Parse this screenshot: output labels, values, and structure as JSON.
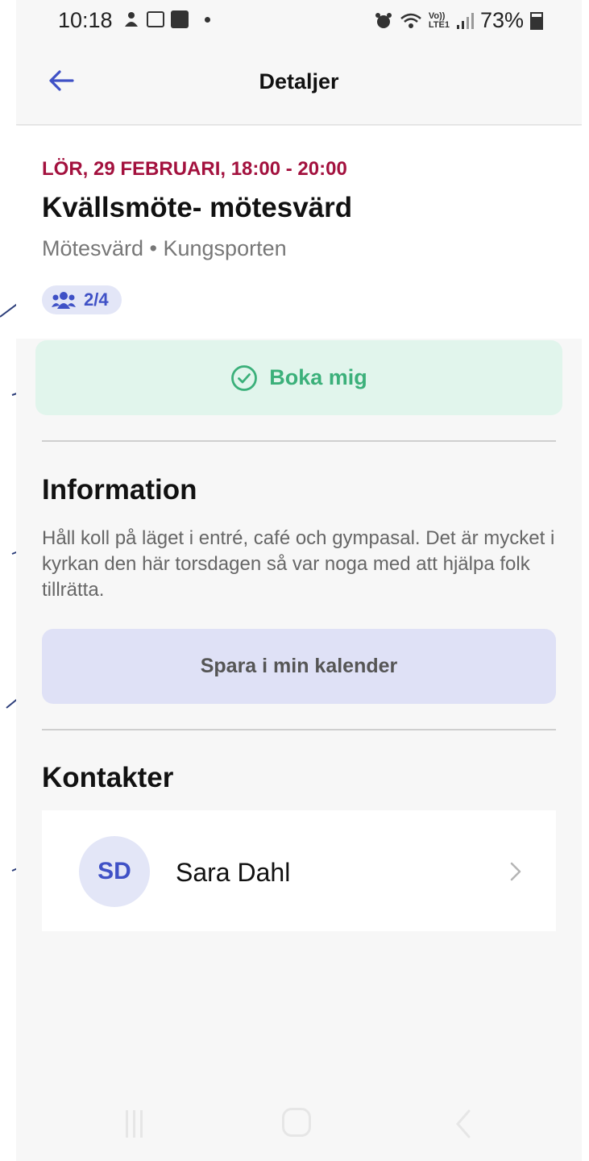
{
  "status_bar": {
    "time": "10:18",
    "network_label": "Vo))\nLTE1",
    "battery": "73%"
  },
  "header": {
    "title": "Detaljer",
    "back_icon": "arrow-left-icon"
  },
  "event": {
    "datetime": "LÖR, 29 FEBRUARI, 18:00 - 20:00",
    "title": "Kvällsmöte- mötesvärd",
    "subtitle": "Mötesvärd • Kungsporten",
    "participants": "2/4"
  },
  "actions": {
    "book_label": "Boka mig",
    "calendar_label": "Spara i min kalender"
  },
  "information": {
    "heading": "Information",
    "text": "Håll koll på läget i entré, café och gympasal. Det är mycket i kyrkan den här torsdagen så var noga med att hjälpa folk tillrätta."
  },
  "contacts": {
    "heading": "Kontakter",
    "items": [
      {
        "initials": "SD",
        "name": "Sara Dahl"
      }
    ]
  },
  "colors": {
    "accent": "#3f51c6",
    "date_red": "#a3113e",
    "book_green": "#3bb07a",
    "book_bg": "#e1f5ec",
    "calendar_bg": "#dfe1f6"
  }
}
